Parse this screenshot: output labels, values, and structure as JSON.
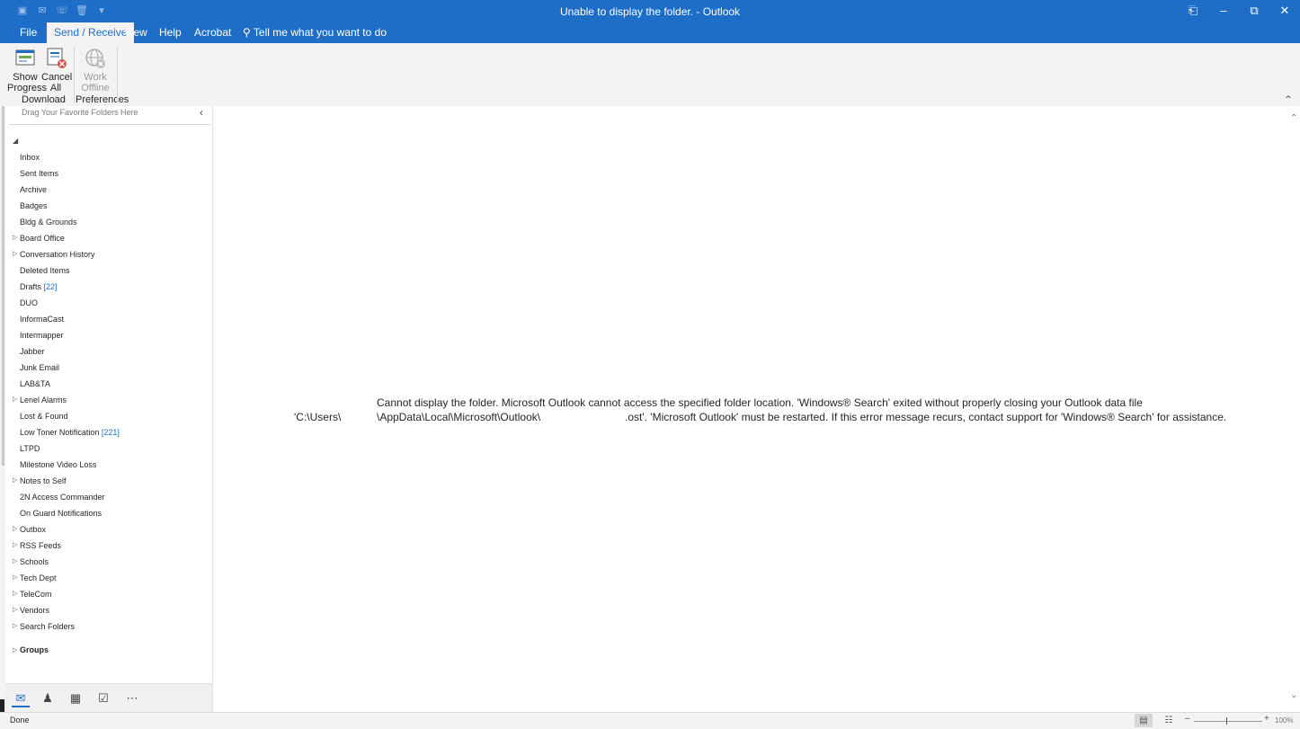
{
  "window": {
    "title": "Unable to display the folder.  -  Outlook",
    "quick_access": [
      "save-icon",
      "send-receive-all-icon",
      "phone-icon",
      "delete-icon",
      "customize-icon"
    ],
    "controls": {
      "ribbon_display": "⎗",
      "minimize": "–",
      "restore": "⧉",
      "close": "✕"
    }
  },
  "menu": {
    "tabs": [
      "File",
      "Send / Receive",
      "View",
      "Help",
      "Acrobat"
    ],
    "active_tab": "Send / Receive",
    "tell_me": "Tell me what you want to do"
  },
  "ribbon": {
    "show_progress": {
      "line1": "Show",
      "line2": "Progress"
    },
    "cancel_all": {
      "line1": "Cancel",
      "line2": "All"
    },
    "work_offline": {
      "line1": "Work",
      "line2": "Offline"
    },
    "groups": {
      "download": "Download",
      "preferences": "Preferences"
    }
  },
  "folder_pane": {
    "favorites_hint": "Drag Your Favorite Folders Here",
    "folders": [
      {
        "name": "Inbox",
        "count": "",
        "expandable": false
      },
      {
        "name": "Sent Items",
        "count": "",
        "expandable": false
      },
      {
        "name": "Archive",
        "count": "",
        "expandable": false
      },
      {
        "name": "Badges",
        "count": "",
        "expandable": false
      },
      {
        "name": "Bldg & Grounds",
        "count": "",
        "expandable": false
      },
      {
        "name": "Board Office",
        "count": "",
        "expandable": true
      },
      {
        "name": "Conversation History",
        "count": "",
        "expandable": true
      },
      {
        "name": "Deleted Items",
        "count": "",
        "expandable": false
      },
      {
        "name": "Drafts",
        "count": "[22]",
        "expandable": false
      },
      {
        "name": "DUO",
        "count": "",
        "expandable": false
      },
      {
        "name": "InformaCast",
        "count": "",
        "expandable": false
      },
      {
        "name": "Intermapper",
        "count": "",
        "expandable": false
      },
      {
        "name": "Jabber",
        "count": "",
        "expandable": false
      },
      {
        "name": "Junk Email",
        "count": "",
        "expandable": false
      },
      {
        "name": "LAB&TA",
        "count": "",
        "expandable": false
      },
      {
        "name": "Lenel Alarms",
        "count": "",
        "expandable": true
      },
      {
        "name": "Lost & Found",
        "count": "",
        "expandable": false
      },
      {
        "name": "Low Toner Notification",
        "count": "[221]",
        "expandable": false
      },
      {
        "name": "LTPD",
        "count": "",
        "expandable": false
      },
      {
        "name": "Milestone Video Loss",
        "count": "",
        "expandable": false
      },
      {
        "name": "Notes to Self",
        "count": "",
        "expandable": true
      },
      {
        "name": "2N Access Commander",
        "count": "",
        "expandable": false
      },
      {
        "name": "On Guard Notifications",
        "count": "",
        "expandable": false
      },
      {
        "name": "Outbox",
        "count": "",
        "expandable": true
      },
      {
        "name": "RSS Feeds",
        "count": "",
        "expandable": true
      },
      {
        "name": "Schools",
        "count": "",
        "expandable": true
      },
      {
        "name": "Tech Dept",
        "count": "",
        "expandable": true
      },
      {
        "name": "TeleCom",
        "count": "",
        "expandable": true
      },
      {
        "name": "Vendors",
        "count": "",
        "expandable": true
      },
      {
        "name": "Search Folders",
        "count": "",
        "expandable": true
      }
    ],
    "groups_label": "Groups"
  },
  "nav": [
    "mail-icon",
    "people-icon",
    "calendar-icon",
    "tasks-icon",
    "more-icon"
  ],
  "error": {
    "line1": "Cannot display the folder. Microsoft Outlook cannot access the specified folder location. 'Windows® Search' exited without properly closing your Outlook data file",
    "line2_prefix": "'C:\\Users\\",
    "line2_path": "\\AppData\\Local\\Microsoft\\Outlook\\",
    "line2_suffix": ".ost'. 'Microsoft Outlook' must be restarted. If this error message recurs, contact support for 'Windows® Search' for assistance."
  },
  "status": {
    "text": "Done",
    "zoom": "100%",
    "zoom_level": 100
  }
}
